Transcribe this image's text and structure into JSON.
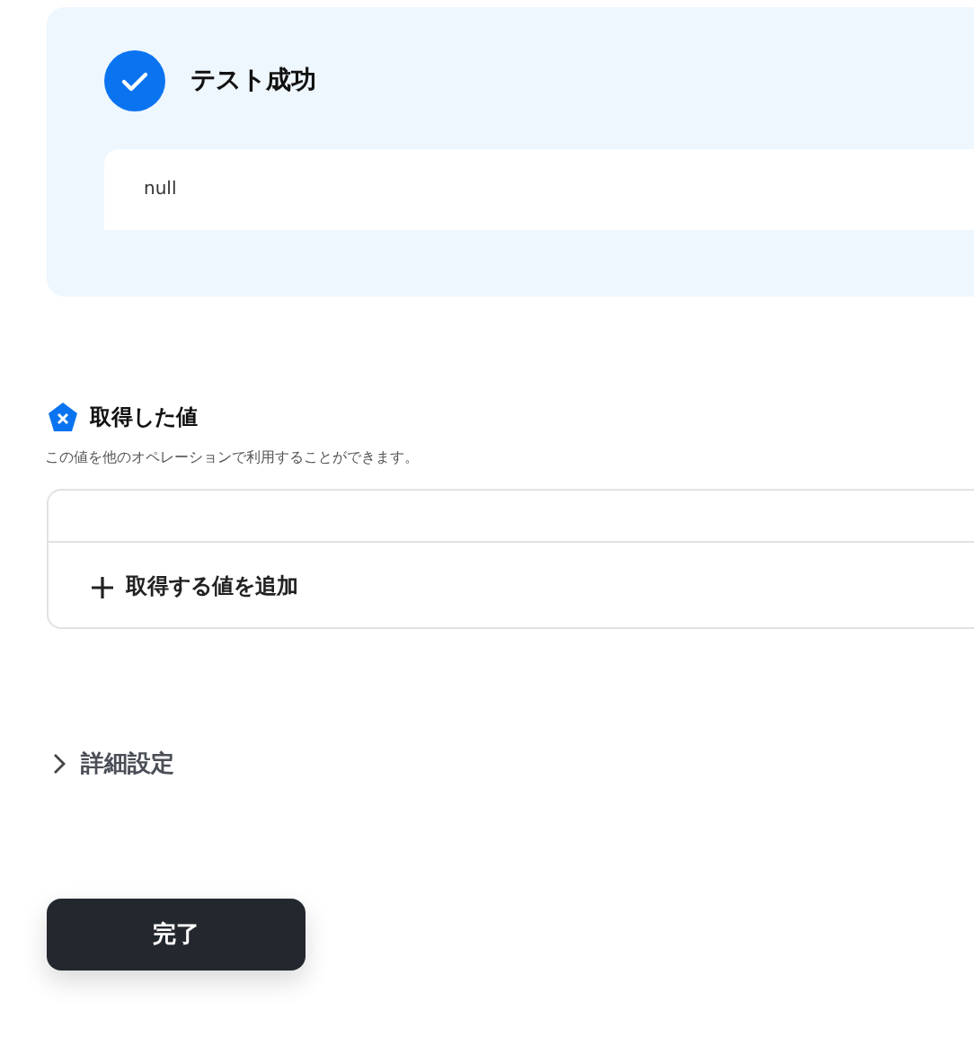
{
  "test_result": {
    "title": "テスト成功",
    "output": "null"
  },
  "acquired_values": {
    "title": "取得した値",
    "description": "この値を他のオペレーションで利用することができます。",
    "add_label": "取得する値を追加"
  },
  "advanced_settings": {
    "label": "詳細設定",
    "expanded": false
  },
  "buttons": [
    {
      "label": "完了"
    }
  ]
}
